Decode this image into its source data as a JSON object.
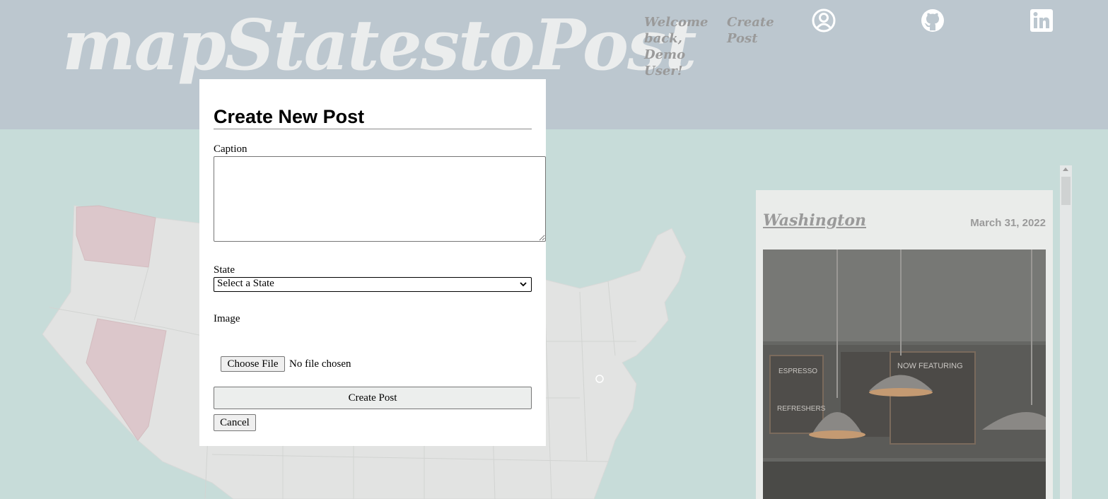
{
  "header": {
    "logo": "mapStatestoPost",
    "welcome_text": "Welcome back, Demo User!",
    "create_post_link": "Create Post",
    "icons": [
      "profile-icon",
      "github-icon",
      "linkedin-icon"
    ]
  },
  "map": {
    "highlighted_states": [
      "Washington",
      "Nevada"
    ],
    "highlight_color": "#dcc7cb",
    "state_color": "#e2e3e2"
  },
  "feed": {
    "post": {
      "state": "Washington",
      "date": "March 31, 2022"
    }
  },
  "modal": {
    "title": "Create New Post",
    "caption_label": "Caption",
    "caption_value": "",
    "state_label": "State",
    "state_selected": "Select a State",
    "image_label": "Image",
    "file_button": "Choose File",
    "file_status": "No file chosen",
    "submit_label": "Create Post",
    "cancel_label": "Cancel"
  },
  "colors": {
    "header_bg": "#bcc7cf",
    "page_bg": "#c7dcd9",
    "logo": "#ebeded",
    "nav_text": "#9a9a9a"
  }
}
